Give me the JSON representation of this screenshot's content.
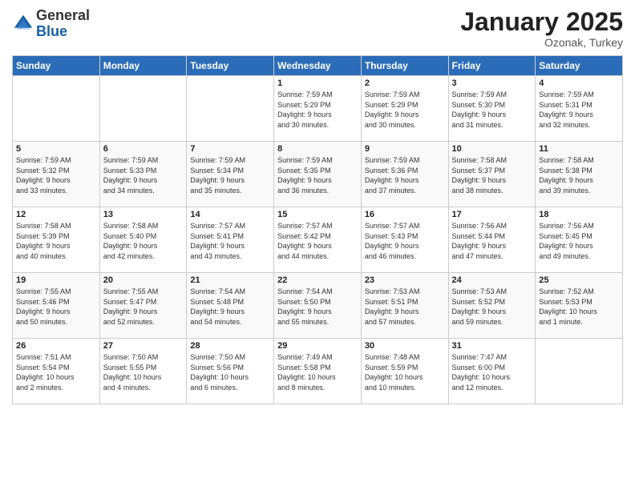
{
  "logo": {
    "general": "General",
    "blue": "Blue"
  },
  "header": {
    "month": "January 2025",
    "location": "Ozonak, Turkey"
  },
  "weekdays": [
    "Sunday",
    "Monday",
    "Tuesday",
    "Wednesday",
    "Thursday",
    "Friday",
    "Saturday"
  ],
  "weeks": [
    [
      {
        "day": "",
        "info": ""
      },
      {
        "day": "",
        "info": ""
      },
      {
        "day": "",
        "info": ""
      },
      {
        "day": "1",
        "info": "Sunrise: 7:59 AM\nSunset: 5:29 PM\nDaylight: 9 hours\nand 30 minutes."
      },
      {
        "day": "2",
        "info": "Sunrise: 7:59 AM\nSunset: 5:29 PM\nDaylight: 9 hours\nand 30 minutes."
      },
      {
        "day": "3",
        "info": "Sunrise: 7:59 AM\nSunset: 5:30 PM\nDaylight: 9 hours\nand 31 minutes."
      },
      {
        "day": "4",
        "info": "Sunrise: 7:59 AM\nSunset: 5:31 PM\nDaylight: 9 hours\nand 32 minutes."
      }
    ],
    [
      {
        "day": "5",
        "info": "Sunrise: 7:59 AM\nSunset: 5:32 PM\nDaylight: 9 hours\nand 33 minutes."
      },
      {
        "day": "6",
        "info": "Sunrise: 7:59 AM\nSunset: 5:33 PM\nDaylight: 9 hours\nand 34 minutes."
      },
      {
        "day": "7",
        "info": "Sunrise: 7:59 AM\nSunset: 5:34 PM\nDaylight: 9 hours\nand 35 minutes."
      },
      {
        "day": "8",
        "info": "Sunrise: 7:59 AM\nSunset: 5:35 PM\nDaylight: 9 hours\nand 36 minutes."
      },
      {
        "day": "9",
        "info": "Sunrise: 7:59 AM\nSunset: 5:36 PM\nDaylight: 9 hours\nand 37 minutes."
      },
      {
        "day": "10",
        "info": "Sunrise: 7:58 AM\nSunset: 5:37 PM\nDaylight: 9 hours\nand 38 minutes."
      },
      {
        "day": "11",
        "info": "Sunrise: 7:58 AM\nSunset: 5:38 PM\nDaylight: 9 hours\nand 39 minutes."
      }
    ],
    [
      {
        "day": "12",
        "info": "Sunrise: 7:58 AM\nSunset: 5:39 PM\nDaylight: 9 hours\nand 40 minutes."
      },
      {
        "day": "13",
        "info": "Sunrise: 7:58 AM\nSunset: 5:40 PM\nDaylight: 9 hours\nand 42 minutes."
      },
      {
        "day": "14",
        "info": "Sunrise: 7:57 AM\nSunset: 5:41 PM\nDaylight: 9 hours\nand 43 minutes."
      },
      {
        "day": "15",
        "info": "Sunrise: 7:57 AM\nSunset: 5:42 PM\nDaylight: 9 hours\nand 44 minutes."
      },
      {
        "day": "16",
        "info": "Sunrise: 7:57 AM\nSunset: 5:43 PM\nDaylight: 9 hours\nand 46 minutes."
      },
      {
        "day": "17",
        "info": "Sunrise: 7:56 AM\nSunset: 5:44 PM\nDaylight: 9 hours\nand 47 minutes."
      },
      {
        "day": "18",
        "info": "Sunrise: 7:56 AM\nSunset: 5:45 PM\nDaylight: 9 hours\nand 49 minutes."
      }
    ],
    [
      {
        "day": "19",
        "info": "Sunrise: 7:55 AM\nSunset: 5:46 PM\nDaylight: 9 hours\nand 50 minutes."
      },
      {
        "day": "20",
        "info": "Sunrise: 7:55 AM\nSunset: 5:47 PM\nDaylight: 9 hours\nand 52 minutes."
      },
      {
        "day": "21",
        "info": "Sunrise: 7:54 AM\nSunset: 5:48 PM\nDaylight: 9 hours\nand 54 minutes."
      },
      {
        "day": "22",
        "info": "Sunrise: 7:54 AM\nSunset: 5:50 PM\nDaylight: 9 hours\nand 55 minutes."
      },
      {
        "day": "23",
        "info": "Sunrise: 7:53 AM\nSunset: 5:51 PM\nDaylight: 9 hours\nand 57 minutes."
      },
      {
        "day": "24",
        "info": "Sunrise: 7:53 AM\nSunset: 5:52 PM\nDaylight: 9 hours\nand 59 minutes."
      },
      {
        "day": "25",
        "info": "Sunrise: 7:52 AM\nSunset: 5:53 PM\nDaylight: 10 hours\nand 1 minute."
      }
    ],
    [
      {
        "day": "26",
        "info": "Sunrise: 7:51 AM\nSunset: 5:54 PM\nDaylight: 10 hours\nand 2 minutes."
      },
      {
        "day": "27",
        "info": "Sunrise: 7:50 AM\nSunset: 5:55 PM\nDaylight: 10 hours\nand 4 minutes."
      },
      {
        "day": "28",
        "info": "Sunrise: 7:50 AM\nSunset: 5:56 PM\nDaylight: 10 hours\nand 6 minutes."
      },
      {
        "day": "29",
        "info": "Sunrise: 7:49 AM\nSunset: 5:58 PM\nDaylight: 10 hours\nand 8 minutes."
      },
      {
        "day": "30",
        "info": "Sunrise: 7:48 AM\nSunset: 5:59 PM\nDaylight: 10 hours\nand 10 minutes."
      },
      {
        "day": "31",
        "info": "Sunrise: 7:47 AM\nSunset: 6:00 PM\nDaylight: 10 hours\nand 12 minutes."
      },
      {
        "day": "",
        "info": ""
      }
    ]
  ]
}
